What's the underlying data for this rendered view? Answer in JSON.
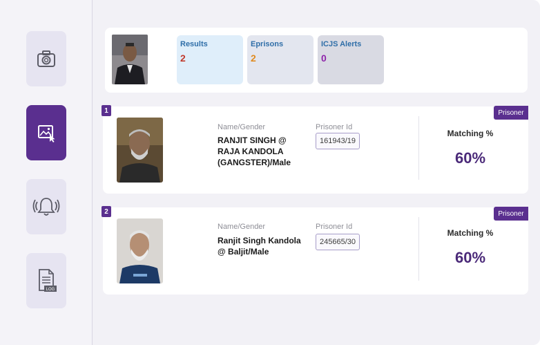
{
  "sidebar": {
    "items": [
      {
        "icon": "camera-icon",
        "active": false
      },
      {
        "icon": "image-select-icon",
        "active": true
      },
      {
        "icon": "bell-alert-icon",
        "active": false
      },
      {
        "icon": "log-file-icon",
        "active": false,
        "badge": "LOG"
      }
    ]
  },
  "summary": {
    "stats": [
      {
        "label": "Results",
        "value": "2",
        "value_color": "#c0392b",
        "bg": "#dfeefa"
      },
      {
        "label": "Eprisons",
        "value": "2",
        "value_color": "#e08a1e",
        "bg": "#e3e6ef"
      },
      {
        "label": "ICJS Alerts",
        "value": "0",
        "value_color": "#8e24aa",
        "bg": "#d9dae3"
      }
    ]
  },
  "results": [
    {
      "index": "1",
      "tag": "Prisoner",
      "name_label": "Name/Gender",
      "name_value": "RANJIT SINGH @ RAJA KANDOLA (GANGSTER)/Male",
      "pid_label": "Prisoner Id",
      "pid_value": "161943/19",
      "match_label": "Matching %",
      "match_value": "60%"
    },
    {
      "index": "2",
      "tag": "Prisoner",
      "name_label": "Name/Gender",
      "name_value": "Ranjit Singh Kandola @ Baljit/Male",
      "pid_label": "Prisoner Id",
      "pid_value": "245665/30",
      "match_label": "Matching %",
      "match_value": "60%"
    }
  ]
}
